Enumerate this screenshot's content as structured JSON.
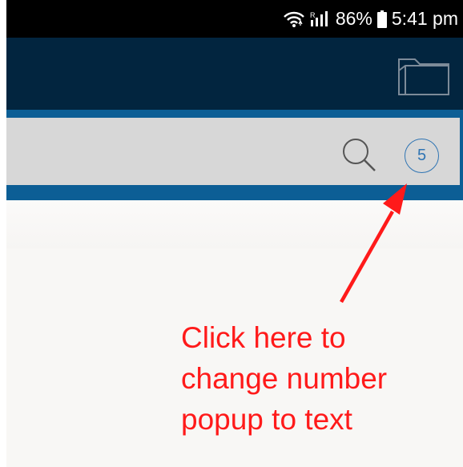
{
  "status_bar": {
    "icons": [
      "wifi-icon",
      "signal-icon"
    ],
    "battery_percent": "86%",
    "time": "5:41 pm"
  },
  "app_bar": {
    "folder_icon": "folder-icon"
  },
  "search": {
    "placeholder": "",
    "search_icon": "search-icon",
    "count_badge": "5",
    "badge_color": "#2f74b3"
  },
  "annotation": {
    "lines": [
      "Click here to",
      "change number",
      "popup to text"
    ],
    "color": "#ff1a1a"
  },
  "colors": {
    "status_bar": "#000000",
    "app_bar": "#02253f",
    "search_band": "#0c5e95",
    "search_bar": "#d7d7d7",
    "content": "#f8f7f5"
  }
}
